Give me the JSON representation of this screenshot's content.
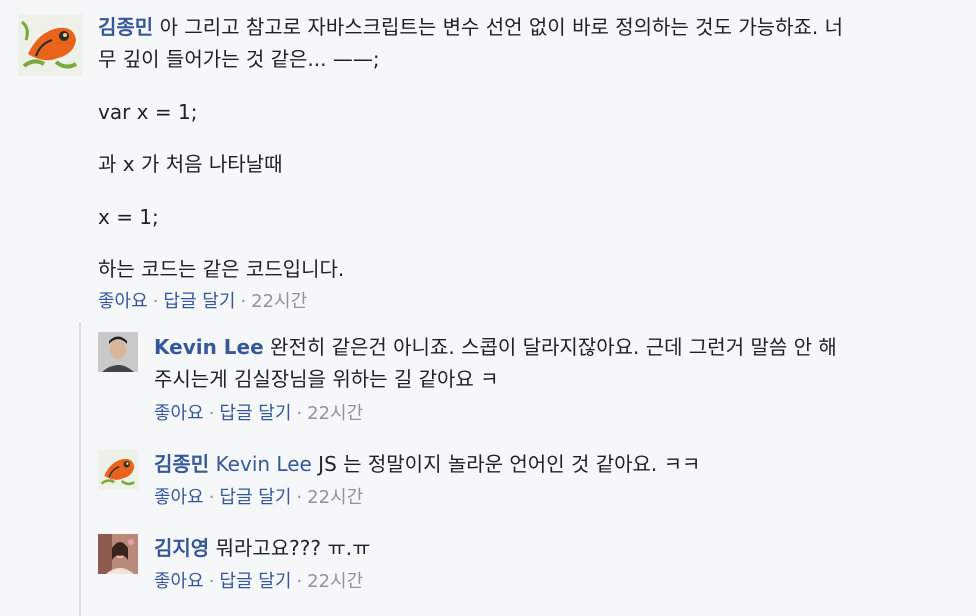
{
  "main_comment": {
    "author": "김종민",
    "text_first_line": "아 그리고 참고로 자바스크립트는 변수 선언 없이 바로 정의하는 것도 가능하죠. 너",
    "text_second_line": "무 깊이 들어가는 것 같은... ——;",
    "paragraphs": [
      "var x = 1;",
      "과 x 가 처음 나타날때",
      "x = 1;",
      "하는 코드는 같은 코드입니다."
    ],
    "like_label": "좋아요",
    "reply_label": "답글 달기",
    "time": "22시간",
    "separator": "·"
  },
  "replies": [
    {
      "author": "Kevin Lee",
      "text_first_line": "완전히 같은건 아니죠. 스콥이 달라지잖아요. 근데 그런거 말씀 안 해",
      "text_second_line": "주시는게 김실장님을 위하는 길 같아요 ㅋ",
      "like_label": "좋아요",
      "reply_label": "답글 달기",
      "time": "22시간",
      "separator": "·"
    },
    {
      "author": "김종민",
      "mention": "Kevin Lee",
      "text": "JS 는 정말이지 놀라운 언어인 것 같아요. ㅋㅋ",
      "like_label": "좋아요",
      "reply_label": "답글 달기",
      "time": "22시간",
      "separator": "·"
    },
    {
      "author": "김지영",
      "text": "뭐라고요??? ㅠ.ㅠ",
      "like_label": "좋아요",
      "reply_label": "답글 달기",
      "time": "22시간",
      "separator": "·"
    }
  ],
  "colors": {
    "background": "#f6f7f9",
    "link": "#365899",
    "text": "#1d2129",
    "muted": "#90949c"
  }
}
